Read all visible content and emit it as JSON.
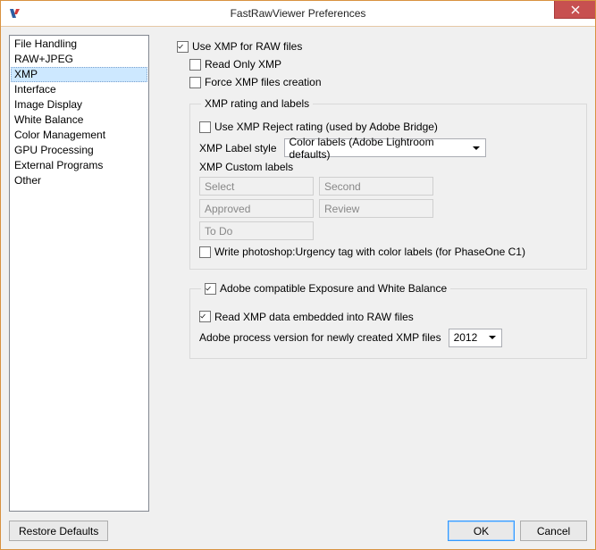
{
  "window": {
    "title": "FastRawViewer Preferences"
  },
  "sidebar": {
    "items": [
      "File Handling",
      "RAW+JPEG",
      "XMP",
      "Interface",
      "Image Display",
      "White Balance",
      "Color Management",
      "GPU Processing",
      "External Programs",
      "Other"
    ],
    "selected_index": 2
  },
  "xmp": {
    "use_xmp": {
      "label": "Use XMP for RAW files",
      "checked": true
    },
    "read_only": {
      "label": "Read Only XMP",
      "checked": false
    },
    "force_create": {
      "label": "Force XMP files creation",
      "checked": false
    },
    "rating_group_title": "XMP rating and labels",
    "use_reject": {
      "label": "Use XMP Reject rating (used by Adobe Bridge)",
      "checked": false
    },
    "label_style_label": "XMP Label style",
    "label_style_value": "Color labels (Adobe Lightroom defaults)",
    "custom_labels_title": "XMP Custom labels",
    "custom_labels": [
      "Select",
      "Second",
      "Approved",
      "Review",
      "To Do"
    ],
    "write_urgency": {
      "label": "Write photoshop:Urgency tag with color labels (for PhaseOne C1)",
      "checked": false
    },
    "adobe_compat": {
      "label": "Adobe compatible Exposure and White Balance",
      "checked": true
    },
    "read_embedded": {
      "label": "Read XMP data embedded into RAW files",
      "checked": true
    },
    "process_version_label": "Adobe process version for newly created XMP files",
    "process_version_value": "2012"
  },
  "footer": {
    "restore": "Restore Defaults",
    "ok": "OK",
    "cancel": "Cancel"
  }
}
